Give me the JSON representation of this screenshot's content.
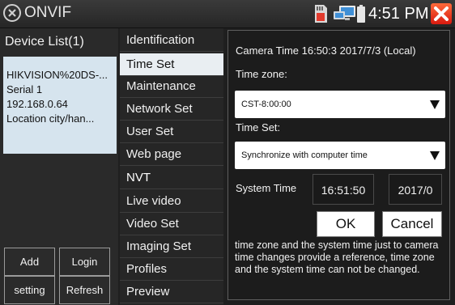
{
  "app": {
    "title": "ONVIF"
  },
  "status": {
    "time": "4:51 PM"
  },
  "devices": {
    "header": "Device List(1)",
    "item": {
      "name": "HIKVISION%20DS-...",
      "serial": "Serial 1",
      "ip": "192.168.0.64",
      "location": "Location city/han..."
    },
    "buttons": {
      "add": "Add",
      "login": "Login",
      "setting": "setting",
      "refresh": "Refresh"
    }
  },
  "menu": {
    "items": [
      {
        "label": "Identification"
      },
      {
        "label": "Time Set",
        "selected": true
      },
      {
        "label": "Maintenance"
      },
      {
        "label": "Network Set"
      },
      {
        "label": "User Set"
      },
      {
        "label": "Web page"
      },
      {
        "label": "NVT"
      },
      {
        "label": "Live video"
      },
      {
        "label": "Video Set"
      },
      {
        "label": "Imaging Set"
      },
      {
        "label": "Profiles"
      },
      {
        "label": "Preview"
      }
    ]
  },
  "timeset": {
    "camera_time": "Camera Time 16:50:3  2017/7/3 (Local)",
    "timezone_label": "Time zone:",
    "timezone_value": "CST-8:00:00",
    "timeset_label": "Time Set:",
    "timeset_value": "Synchronize with computer time",
    "system_time_label": "System Time",
    "system_time": "16:51:50",
    "system_date": "2017/0",
    "ok": "OK",
    "cancel": "Cancel",
    "note": "time zone and the system time just to camera time changes provide a reference, time zone and the system time can not be changed."
  },
  "colors": {
    "selected_bg": "#e9eef2",
    "device_card_bg": "#d6e4ee",
    "close_red": "#e0241a"
  },
  "icons": [
    "onvif-logo-icon",
    "sd-card-icon",
    "network-icon",
    "battery-icon",
    "close-icon",
    "dropdown-arrow-icon"
  ]
}
